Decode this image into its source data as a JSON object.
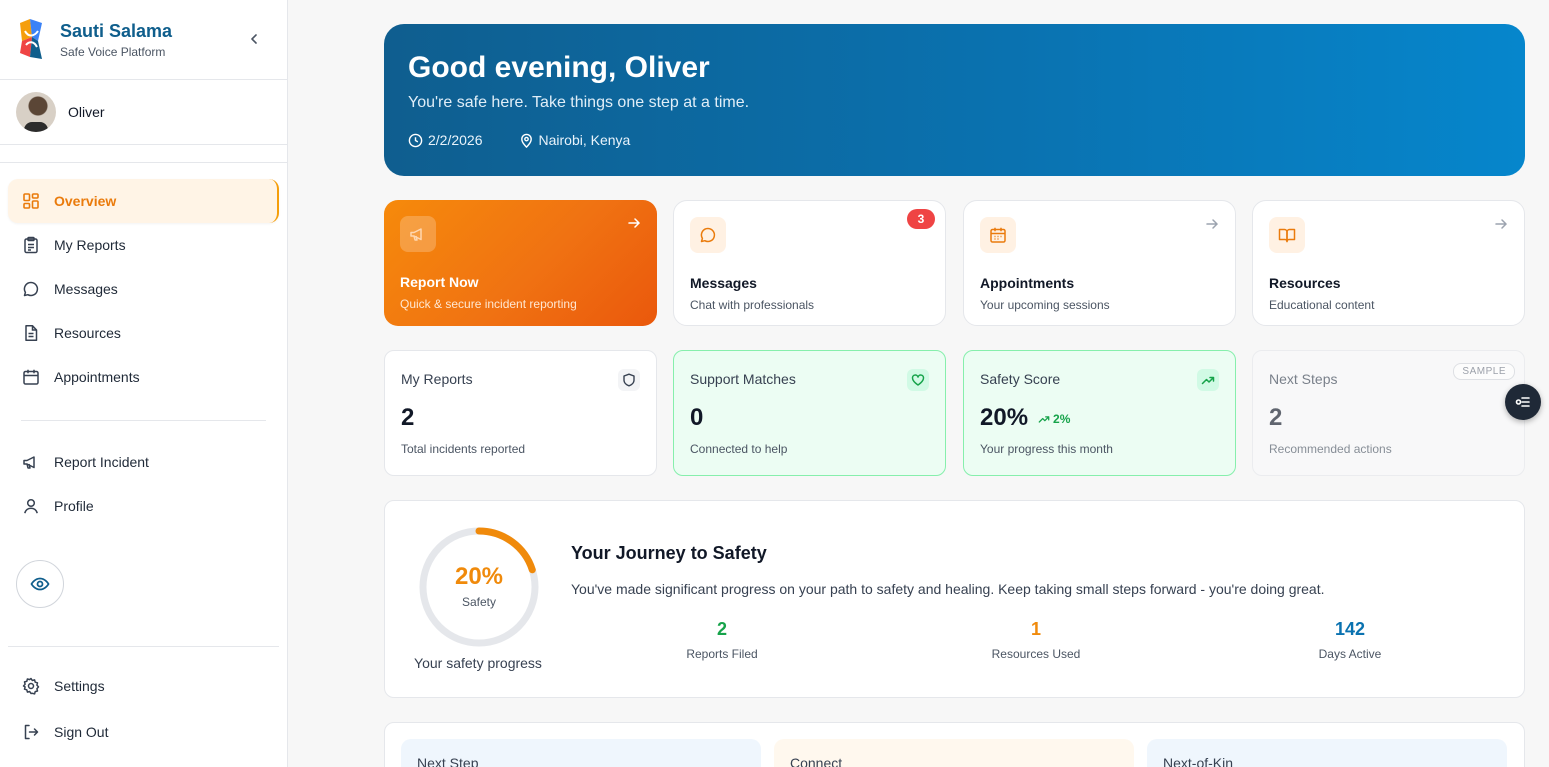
{
  "brand": {
    "title": "Sauti Salama",
    "subtitle": "Safe Voice Platform"
  },
  "user": {
    "name": "Oliver"
  },
  "nav": {
    "items": [
      {
        "label": "Overview",
        "icon": "grid-icon",
        "active": true
      },
      {
        "label": "My Reports",
        "icon": "clipboard-icon"
      },
      {
        "label": "Messages",
        "icon": "message-circle-icon"
      },
      {
        "label": "Resources",
        "icon": "file-text-icon"
      },
      {
        "label": "Appointments",
        "icon": "calendar-icon"
      }
    ],
    "secondary": [
      {
        "label": "Report Incident",
        "icon": "megaphone-icon"
      },
      {
        "label": "Profile",
        "icon": "user-icon"
      }
    ],
    "bottom": [
      {
        "label": "Settings",
        "icon": "gear-icon"
      },
      {
        "label": "Sign Out",
        "icon": "log-out-icon"
      }
    ]
  },
  "hero": {
    "greeting": "Good evening, Oliver",
    "subtitle": "You're safe here. Take things one step at a time.",
    "date": "2/2/2026",
    "location": "Nairobi, Kenya"
  },
  "quick_actions": [
    {
      "title": "Report Now",
      "subtitle": "Quick & secure incident reporting"
    },
    {
      "title": "Messages",
      "subtitle": "Chat with professionals",
      "badge": "3"
    },
    {
      "title": "Appointments",
      "subtitle": "Your upcoming sessions"
    },
    {
      "title": "Resources",
      "subtitle": "Educational content"
    }
  ],
  "stats": [
    {
      "label": "My Reports",
      "value": "2",
      "sub": "Total incidents reported"
    },
    {
      "label": "Support Matches",
      "value": "0",
      "sub": "Connected to help"
    },
    {
      "label": "Safety Score",
      "value": "20%",
      "trend": "2%",
      "sub": "Your progress this month"
    },
    {
      "label": "Next Steps",
      "value": "2",
      "sub": "Recommended actions",
      "tag": "SAMPLE"
    }
  ],
  "journey": {
    "percent_label": "20%",
    "percent": 20,
    "ring_label": "Safety",
    "caption": "Your safety progress",
    "title": "Your Journey to Safety",
    "text": "You've made significant progress on your path to safety and healing. Keep taking small steps forward - you're doing great.",
    "stats": [
      {
        "value": "2",
        "label": "Reports Filed"
      },
      {
        "value": "1",
        "label": "Resources Used"
      },
      {
        "value": "142",
        "label": "Days Active"
      }
    ]
  },
  "bottom_cards": [
    {
      "label": "Next Step"
    },
    {
      "label": "Connect"
    },
    {
      "label": "Next-of-Kin"
    }
  ],
  "colors": {
    "brand_blue": "#0f5e8c",
    "accent_orange": "#f08a0b",
    "success_green": "#16a34a",
    "days_blue": "#0a72b0",
    "badge_red": "#ef4444"
  }
}
